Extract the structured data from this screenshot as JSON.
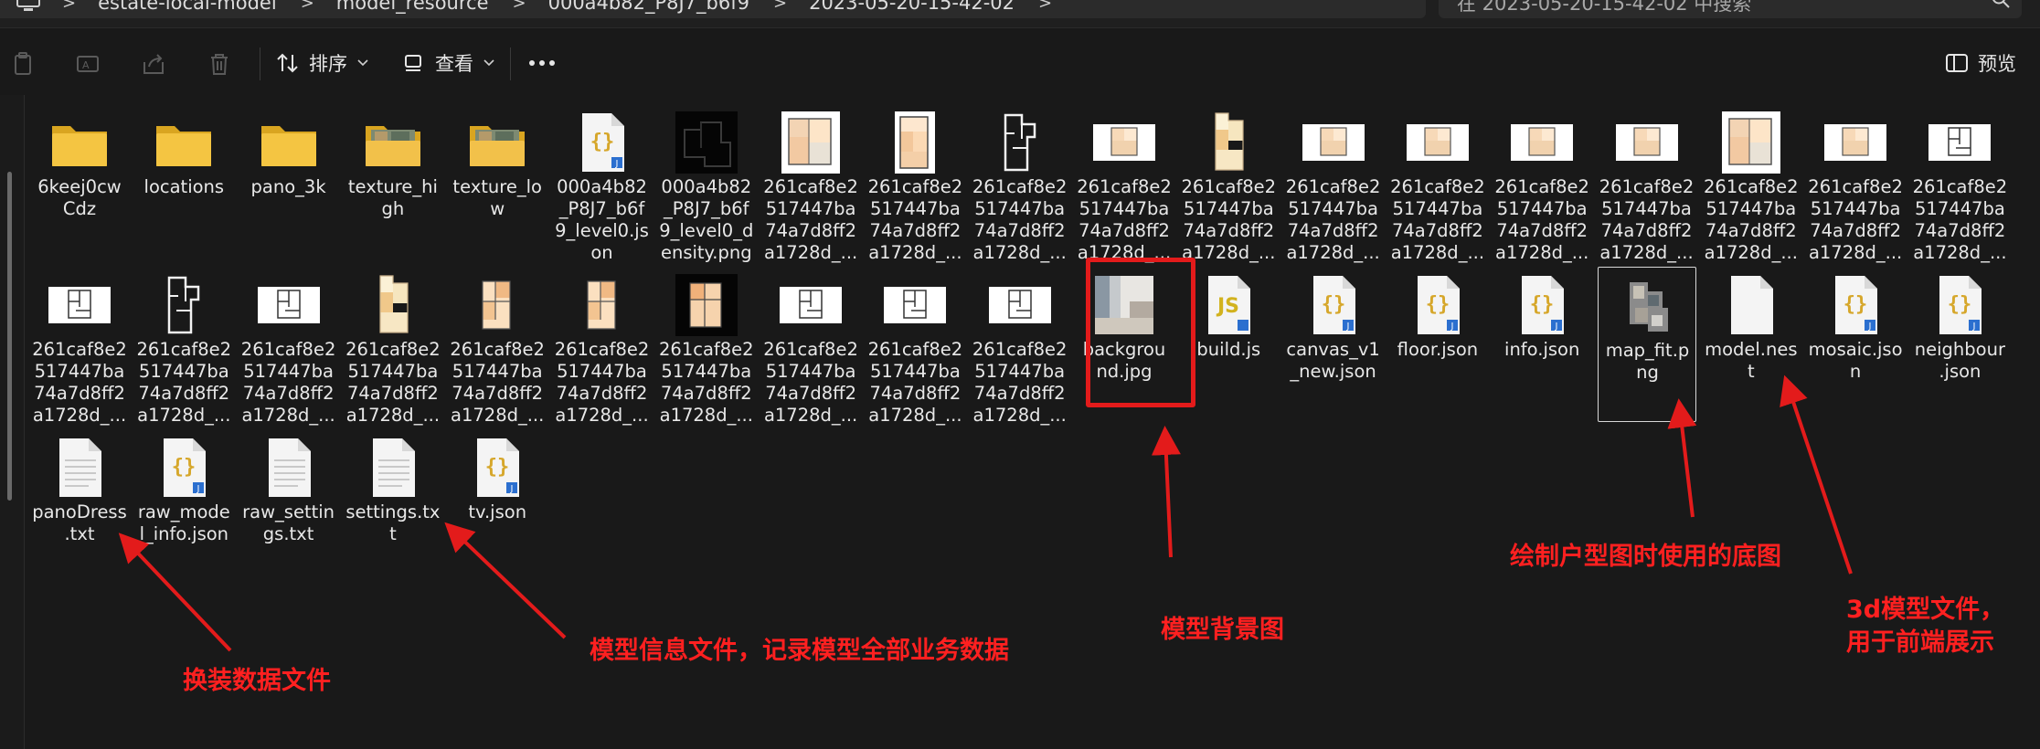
{
  "breadcrumb": {
    "items": [
      "estate-local-model",
      "model_resource",
      "000a4b82_P8J7_b6f9",
      "2023-05-20-15-42-02"
    ]
  },
  "search": {
    "placeholder": "在 2023-05-20-15-42-02 中搜索"
  },
  "toolbar": {
    "sort_label": "排序",
    "view_label": "查看",
    "preview_label": "预览"
  },
  "files": [
    {
      "name": "6keej0cw\nCdz",
      "type": "folder"
    },
    {
      "name": "locations",
      "type": "folder"
    },
    {
      "name": "pano_3k",
      "type": "folder"
    },
    {
      "name": "texture_hi\ngh",
      "type": "folder-photo"
    },
    {
      "name": "texture_lo\nw",
      "type": "folder-photo"
    },
    {
      "name": "000a4b82\n_P8J7_b6f\n9_level0.js\non",
      "type": "json"
    },
    {
      "name": "000a4b82\n_P8J7_b6f\n9_level0_d\nensity.png",
      "type": "density"
    },
    {
      "name": "261caf8e2\n517447ba\n74a7d8ff2\na1728d_...",
      "type": "plan-color"
    },
    {
      "name": "261caf8e2\n517447ba\n74a7d8ff2\na1728d_...",
      "type": "plan-color-tall"
    },
    {
      "name": "261caf8e2\n517447ba\n74a7d8ff2\na1728d_...",
      "type": "plan-line-tall"
    },
    {
      "name": "261caf8e2\n517447ba\n74a7d8ff2\na1728d_...",
      "type": "plan-small-color"
    },
    {
      "name": "261caf8e2\n517447ba\n74a7d8ff2\na1728d_...",
      "type": "plan-beige-tall"
    },
    {
      "name": "261caf8e2\n517447ba\n74a7d8ff2\na1728d_...",
      "type": "plan-small-color"
    },
    {
      "name": "261caf8e2\n517447ba\n74a7d8ff2\na1728d_...",
      "type": "plan-small-color"
    },
    {
      "name": "261caf8e2\n517447ba\n74a7d8ff2\na1728d_...",
      "type": "plan-small-color"
    },
    {
      "name": "261caf8e2\n517447ba\n74a7d8ff2\na1728d_...",
      "type": "plan-small-color"
    },
    {
      "name": "261caf8e2\n517447ba\n74a7d8ff2\na1728d_...",
      "type": "plan-color"
    },
    {
      "name": "261caf8e2\n517447ba\n74a7d8ff2\na1728d_...",
      "type": "plan-small-color"
    },
    {
      "name": "261caf8e2\n517447ba\n74a7d8ff2\na1728d_...",
      "type": "plan-small-line"
    },
    {
      "name": "261caf8e2\n517447ba\n74a7d8ff2\na1728d_...",
      "type": "plan-small-line"
    },
    {
      "name": "261caf8e2\n517447ba\n74a7d8ff2\na1728d_...",
      "type": "plan-line-tall"
    },
    {
      "name": "261caf8e2\n517447ba\n74a7d8ff2\na1728d_...",
      "type": "plan-small-line"
    },
    {
      "name": "261caf8e2\n517447ba\n74a7d8ff2\na1728d_...",
      "type": "plan-beige-tall"
    },
    {
      "name": "261caf8e2\n517447ba\n74a7d8ff2\na1728d_...",
      "type": "plan-orange"
    },
    {
      "name": "261caf8e2\n517447ba\n74a7d8ff2\na1728d_...",
      "type": "plan-orange"
    },
    {
      "name": "261caf8e2\n517447ba\n74a7d8ff2\na1728d_...",
      "type": "plan-orange-dark"
    },
    {
      "name": "261caf8e2\n517447ba\n74a7d8ff2\na1728d_...",
      "type": "plan-small-line"
    },
    {
      "name": "261caf8e2\n517447ba\n74a7d8ff2\na1728d_...",
      "type": "plan-small-line"
    },
    {
      "name": "261caf8e2\n517447ba\n74a7d8ff2\na1728d_...",
      "type": "plan-small-line"
    },
    {
      "name": "backgrou\nnd.jpg",
      "type": "photo"
    },
    {
      "name": "build.js",
      "type": "js"
    },
    {
      "name": "canvas_v1\n_new.json",
      "type": "json"
    },
    {
      "name": "floor.json",
      "type": "json"
    },
    {
      "name": "info.json",
      "type": "json"
    },
    {
      "name": "map_fit.p\nng",
      "type": "mapfit",
      "selected": true
    },
    {
      "name": "model.nes\nt",
      "type": "blank"
    },
    {
      "name": "mosaic.jso\nn",
      "type": "json"
    },
    {
      "name": "neighbour\n.json",
      "type": "json"
    },
    {
      "name": "panoDress\n.txt",
      "type": "txt"
    },
    {
      "name": "raw_mode\nl_info.json",
      "type": "json"
    },
    {
      "name": "raw_settin\ngs.txt",
      "type": "txt"
    },
    {
      "name": "settings.tx\nt",
      "type": "txt"
    },
    {
      "name": "tv.json",
      "type": "json"
    }
  ],
  "annotations": {
    "dress": "换装数据文件",
    "model_info": "模型信息文件，记录模型全部业务数据",
    "background": "模型背景图",
    "floorplan": "绘制户型图时使用的底图",
    "nest_line1": "3d模型文件，",
    "nest_line2": "用于前端展示"
  },
  "colors": {
    "annotation_red": "#ff2020",
    "folder_yellow": "#f4c542",
    "json_blue": "#2b6fcf"
  }
}
